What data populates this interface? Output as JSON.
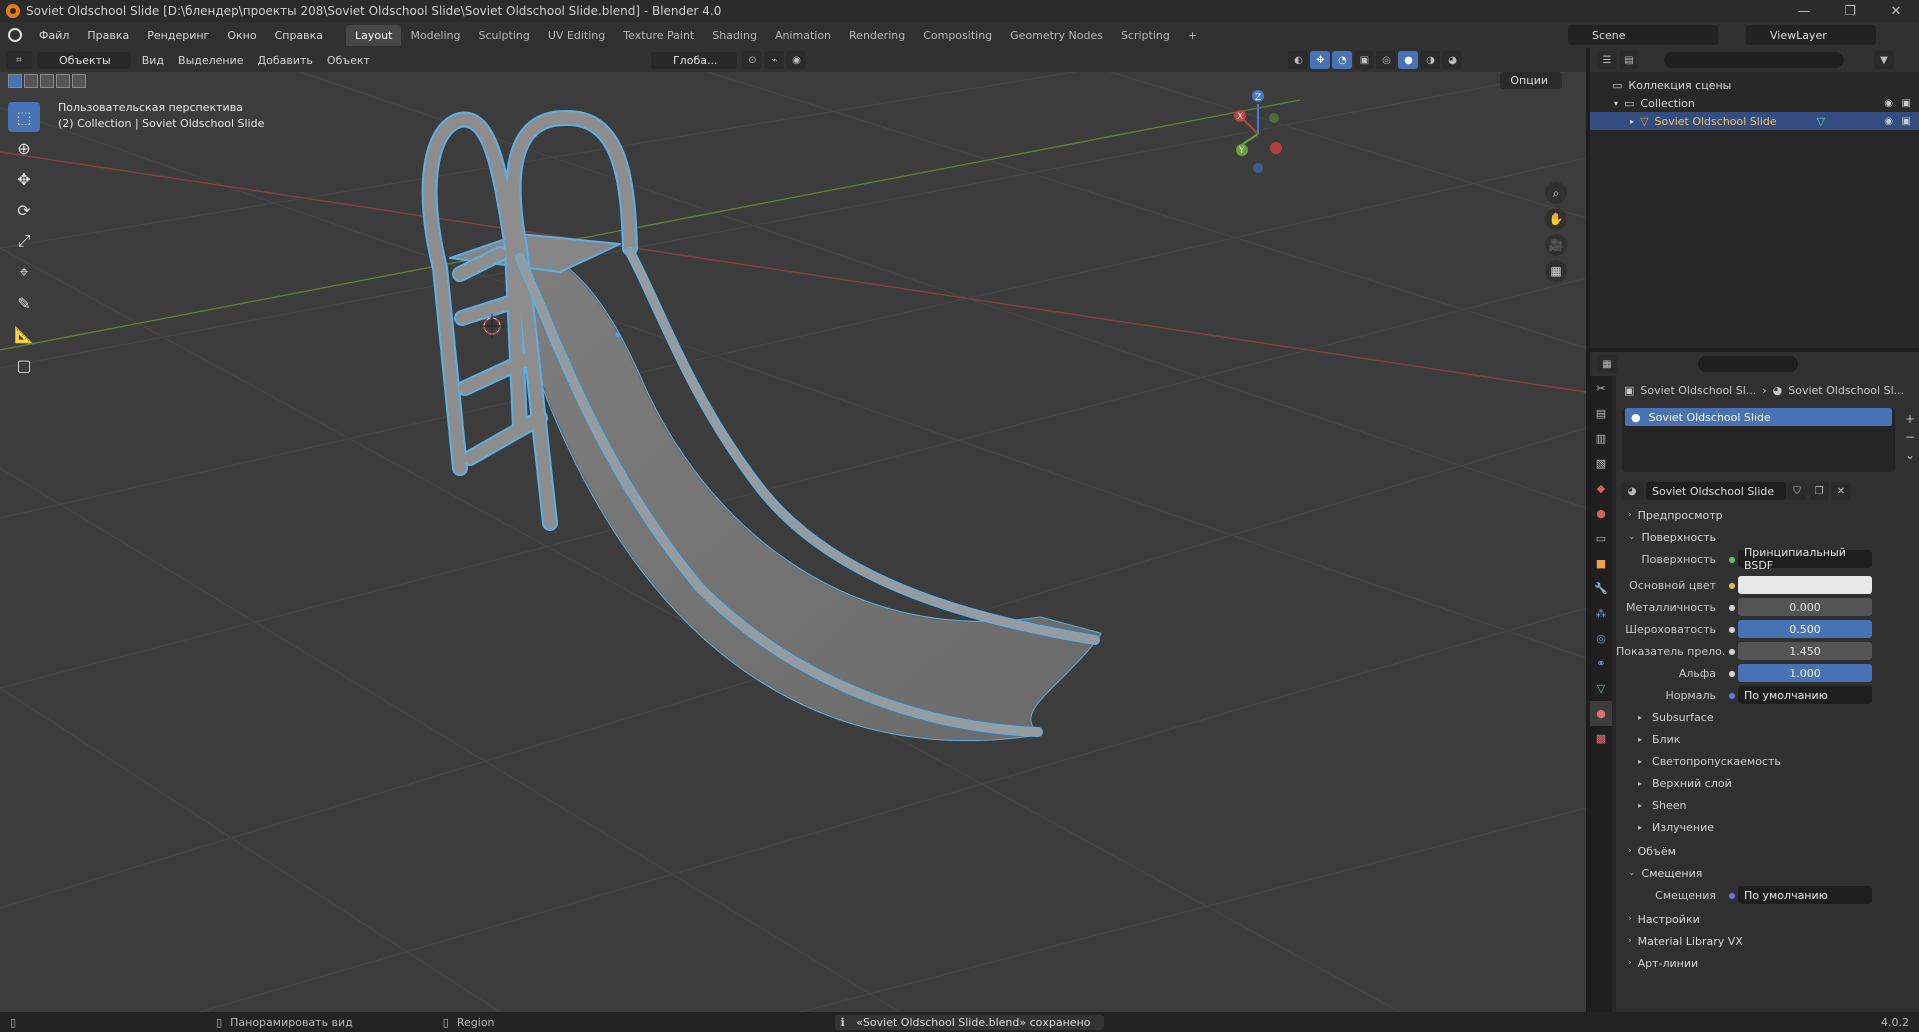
{
  "window": {
    "title": "Soviet Oldschool Slide [D:\\блендер\\проекты 208\\Soviet Oldschool Slide\\Soviet Oldschool Slide.blend] - Blender 4.0",
    "controls": [
      "—",
      "❐",
      "✕"
    ]
  },
  "menu": {
    "items": [
      "Файл",
      "Правка",
      "Рендеринг",
      "Окно",
      "Справка"
    ],
    "workspaces": [
      "Layout",
      "Modeling",
      "Sculpting",
      "UV Editing",
      "Texture Paint",
      "Shading",
      "Animation",
      "Rendering",
      "Compositing",
      "Geometry Nodes",
      "Scripting",
      "+"
    ],
    "active_workspace": "Layout",
    "scene": "Scene",
    "view_layer": "ViewLayer"
  },
  "viewport": {
    "mode": "Объекты",
    "menus": [
      "Вид",
      "Выделение",
      "Добавить",
      "Объект"
    ],
    "transform_orientation": "Глоба...",
    "options_label": "Опции",
    "info_line1": "Пользовательская перспектива",
    "info_line2": "(2) Collection | Soviet Oldschool Slide",
    "gizmo": {
      "z": "Z",
      "y": "Y",
      "x": "X"
    },
    "colors": {
      "background": "#3c3c3c",
      "selection_outline": "#5ab0e6",
      "x_axis": "#b34a4a",
      "y_axis": "#6a9a3a",
      "accent": "#4772b3"
    }
  },
  "outliner": {
    "root": "Коллекция сцены",
    "collection": "Collection",
    "object": "Soviet Oldschool Slide"
  },
  "properties": {
    "breadcrumb_object": "Soviet Oldschool Sl...",
    "breadcrumb_material": "Soviet Oldschool Sl...",
    "slot_name": "Soviet Oldschool Slide",
    "material_name": "Soviet Oldschool Slide",
    "sections": {
      "preview": "Предпросмотр",
      "surface": "Поверхность",
      "volume": "Объём",
      "displacement": "Смещения",
      "settings": "Настройки",
      "material_library": "Material Library VX",
      "lineart": "Арт-линии"
    },
    "surface_rows": [
      {
        "label": "Поверхность",
        "value": "Принципиальный BSDF",
        "style": "dark"
      },
      {
        "label": "Основной цвет",
        "value": "",
        "style": "white"
      },
      {
        "label": "Металличность",
        "value": "0.000",
        "style": "grey"
      },
      {
        "label": "Шероховатость",
        "value": "0.500",
        "style": "blue"
      },
      {
        "label": "Показатель прело...",
        "value": "1.450",
        "style": "grey"
      },
      {
        "label": "Альфа",
        "value": "1.000",
        "style": "blue"
      },
      {
        "label": "Нормаль",
        "value": "По умолчанию",
        "style": "dark"
      }
    ],
    "subpanels": [
      "Subsurface",
      "Блик",
      "Светопропускаемость",
      "Верхний слой",
      "Sheen",
      "Излучение"
    ],
    "displacement_row": {
      "label": "Смещения",
      "value": "По умолчанию"
    }
  },
  "status": {
    "pan": "Панорамировать вид",
    "region": "Region",
    "message": "«Soviet Oldschool Slide.blend» сохранено",
    "version": "4.0.2"
  }
}
